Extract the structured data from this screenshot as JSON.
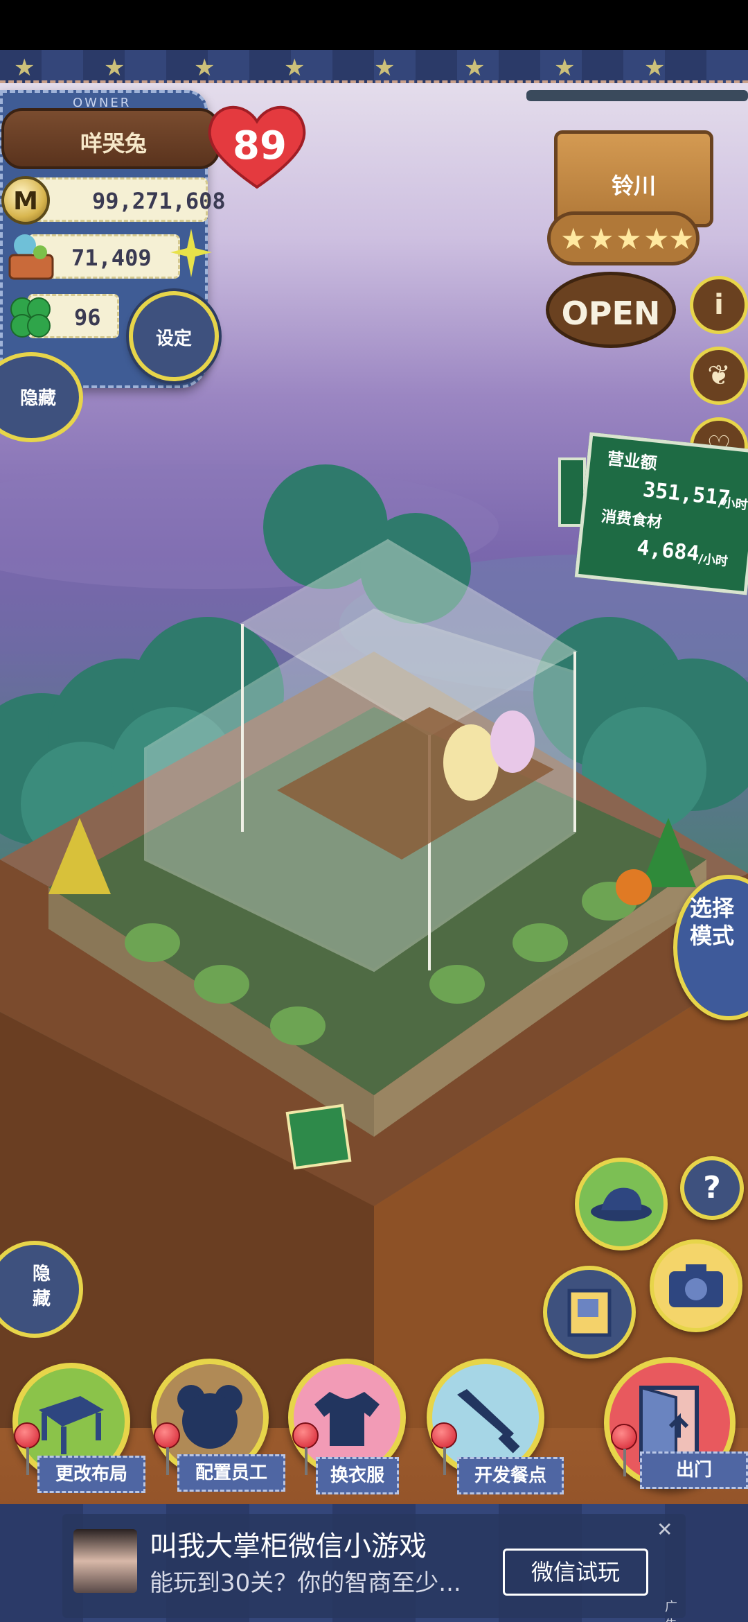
{
  "owner": {
    "label": "OWNER",
    "name": "咩哭兔",
    "heart_level": "89"
  },
  "resources": {
    "coins": "99,271,608",
    "food": "71,409",
    "clover": "96",
    "coin_icon_letter": "M"
  },
  "buttons_top": {
    "settings": "设定",
    "hide": "隐藏"
  },
  "shop_sign": {
    "name": "铃川",
    "stars": 5,
    "status": "OPEN"
  },
  "side_icons": [
    "info-icon",
    "recipe-book-icon",
    "heart-icon"
  ],
  "revenue": {
    "title": "营业额",
    "income": "351,517",
    "income_unit": "/小时",
    "consume_title": "消费食材",
    "consume": "4,684",
    "consume_unit": "/小时"
  },
  "mode_button": "选择\n模式",
  "hide_bottom": "隐\n藏",
  "menu": [
    {
      "label": "更改布局",
      "icon": "table-icon",
      "color": "#8bc34a"
    },
    {
      "label": "配置员工",
      "icon": "bear-head-icon",
      "color": "#b08a56"
    },
    {
      "label": "换衣服",
      "icon": "shirt-icon",
      "color": "#f29bb6"
    },
    {
      "label": "开发餐点",
      "icon": "knife-icon",
      "color": "#a6d6e6"
    },
    {
      "label": "出门",
      "icon": "door-icon",
      "color": "#e8595e"
    }
  ],
  "ad": {
    "title": "叫我大掌柜微信小游戏",
    "subtitle": "能玩到30关？你的智商至少...",
    "button": "微信试玩",
    "close": "✕",
    "tag": "广告"
  },
  "colors": {
    "accent_yellow": "#e7d54a",
    "panel_blue": "#3f5c95",
    "board_green": "#1e6b44"
  }
}
